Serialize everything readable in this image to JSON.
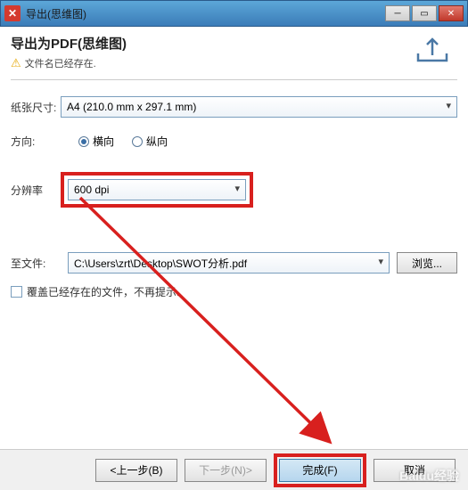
{
  "titlebar": {
    "text": "导出(思维图)"
  },
  "header": {
    "title": "导出为PDF(思维图)",
    "warning": "文件名已经存在."
  },
  "form": {
    "paper_size": {
      "label": "纸张尺寸:",
      "value": "A4 (210.0 mm x 297.1 mm)"
    },
    "orientation": {
      "label": "方向:",
      "opt_landscape": "横向",
      "opt_portrait": "纵向"
    },
    "resolution": {
      "label": "分辨率",
      "value": "600 dpi"
    },
    "destfile": {
      "label": "至文件:",
      "value": "C:\\Users\\zrt\\Desktop\\SWOT分析.pdf",
      "browse": "浏览..."
    },
    "overwrite": {
      "label": "覆盖已经存在的文件，不再提示."
    }
  },
  "buttons": {
    "prev": "<上一步(B)",
    "next": "下一步(N)>",
    "finish": "完成(F)",
    "cancel": "取消"
  },
  "watermark": "Baidu经验"
}
